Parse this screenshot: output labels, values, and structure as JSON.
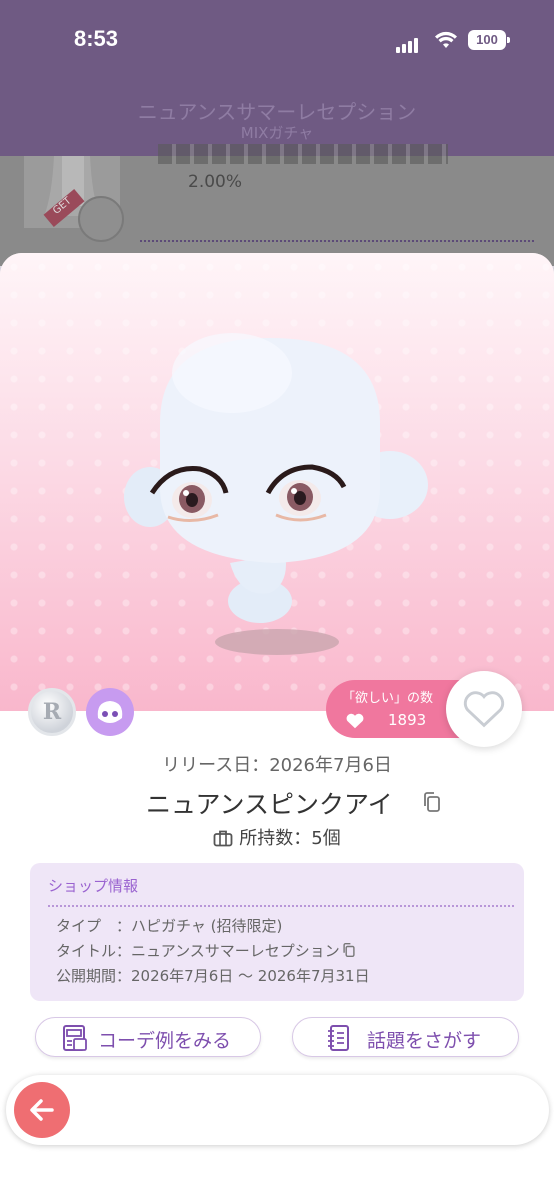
{
  "status_bar": {
    "time": "8:53",
    "battery": "100"
  },
  "header": {
    "title": "ニュアンスサマーレセプション",
    "subtitle": "MIXガチャ"
  },
  "background_list": {
    "rate": "2.00%",
    "get_badge": "GET"
  },
  "item": {
    "release_date": "リリース日：2026年7月6日",
    "name": "ニュアンスピンクアイ",
    "owned": "所持数：5個",
    "rarity_badge": "R",
    "want_label": "「欲しい」の数",
    "want_count": "1893"
  },
  "shop_info": {
    "title": "ショップ情報",
    "rows": [
      {
        "text": "タイプ　：ハピガチャ (招待限定)"
      },
      {
        "text": "タイトル：ニュアンスサマーレセプション"
      },
      {
        "text": "公開期間：2026年7月6日 ～ 2026年7月31日"
      }
    ]
  },
  "actions": {
    "code_examples": "コーデ例をみる",
    "find_topics": "話題をさがす"
  },
  "icons": {
    "copy": "copy-icon",
    "bag": "bag-icon",
    "heart": "heart-icon",
    "back": "back-arrow-icon",
    "outfit": "outfit-icon",
    "notebook": "notebook-icon"
  },
  "colors": {
    "header_bg": "#6f5a83",
    "want_pill": "#f0779e",
    "accent_purple": "#7e4fae",
    "shop_bg": "#efe6f7",
    "back_button": "#ef6e72"
  }
}
